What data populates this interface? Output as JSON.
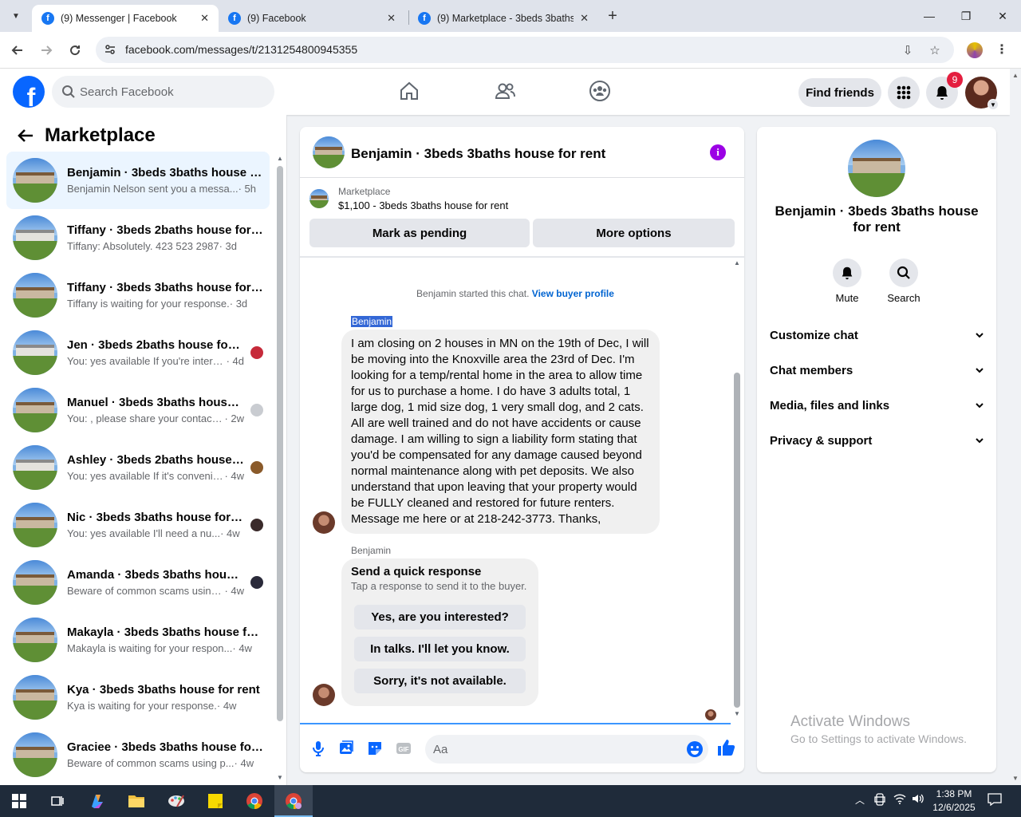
{
  "browser": {
    "tabs": [
      {
        "title": "(9) Messenger | Facebook",
        "active": true
      },
      {
        "title": "(9) Facebook",
        "active": false
      },
      {
        "title": "(9) Marketplace - 3beds 3baths",
        "active": false
      }
    ],
    "url": "facebook.com/messages/t/2131254800945355"
  },
  "fb_header": {
    "search_placeholder": "Search Facebook",
    "find_friends": "Find friends",
    "notification_count": "9"
  },
  "left_panel": {
    "title": "Marketplace",
    "conversations": [
      {
        "name": "Benjamin · 3beds 3baths house for rent",
        "preview": "Benjamin Nelson sent you a messa...",
        "time": "· 5h",
        "selected": true,
        "thumb": "brick"
      },
      {
        "name": "Tiffany · 3beds 2baths house for rent",
        "preview": "Tiffany: Absolutely. 423 523 2987",
        "time": "· 3d",
        "thumb": "white"
      },
      {
        "name": "Tiffany · 3beds 3baths house for rent",
        "preview": "Tiffany is waiting for your response.",
        "time": "· 3d",
        "thumb": "brick"
      },
      {
        "name": "Jen · 3beds 2baths house for rent",
        "preview": "You: yes available If you're intere...",
        "time": "· 4d",
        "thumb": "white",
        "mini": "#c62a3a"
      },
      {
        "name": "Manuel · 3beds 3baths house for rent",
        "preview": "You: , please share your contact ...",
        "time": "· 2w",
        "thumb": "brick",
        "mini": "#c9ccd1"
      },
      {
        "name": "Ashley · 3beds 2baths house for rent",
        "preview": "You: yes available If it's convenie...",
        "time": "· 4w",
        "thumb": "white",
        "mini": "#8a5a2a"
      },
      {
        "name": "Nic · 3beds 3baths house for rent",
        "preview": "You: yes available I'll need a nu...",
        "time": "· 4w",
        "thumb": "brick",
        "mini": "#3a2a2a"
      },
      {
        "name": "Amanda · 3beds 3baths house for rent",
        "preview": "Beware of common scams using...",
        "time": "· 4w",
        "thumb": "brick",
        "mini": "#2a2a3a"
      },
      {
        "name": "Makayla · 3beds 3baths house for rent",
        "preview": "Makayla is waiting for your respon...",
        "time": "· 4w",
        "thumb": "brick"
      },
      {
        "name": "Kya · 3beds 3baths house for rent",
        "preview": "Kya is waiting for your response.",
        "time": "· 4w",
        "thumb": "brick"
      },
      {
        "name": "Graciee · 3beds 3baths house for rent",
        "preview": "Beware of common scams using p...",
        "time": "· 4w",
        "thumb": "brick"
      }
    ]
  },
  "chat": {
    "title": "Benjamin · 3beds 3baths house for rent",
    "marketplace_label": "Marketplace",
    "listing": "$1,100 - 3beds 3baths house for rent",
    "mark_pending": "Mark as pending",
    "more_options": "More options",
    "started_text": "Benjamin started this chat.",
    "view_buyer_profile": "View buyer profile",
    "sender": "Benjamin",
    "message": "I am closing on 2 houses in MN on the 19th of Dec, I will be moving into the Knoxville area the 23rd of Dec. I'm looking for a temp/rental home in the area to allow time for us to purchase a home. I do have 3 adults total, 1 large dog, 1 mid size dog, 1 very small dog, and 2 cats. All are well trained and do not have accidents or cause damage. I am willing to sign a liability form stating that you'd be compensated for any damage caused beyond normal maintenance along with pet deposits. We also understand that upon leaving that your property would be FULLY cleaned and restored for future renters. Message me here or at 218-242-3773. Thanks,",
    "quick_title": "Send a quick response",
    "quick_sub": "Tap a response to send it to the buyer.",
    "quick_replies": [
      "Yes, are you interested?",
      "In talks. I'll let you know.",
      "Sorry, it's not available."
    ],
    "composer_placeholder": "Aa"
  },
  "right_panel": {
    "title": "Benjamin · 3beds 3baths house for rent",
    "mute": "Mute",
    "search": "Search",
    "sections": [
      "Customize chat",
      "Chat members",
      "Media, files and links",
      "Privacy & support"
    ]
  },
  "watermark": {
    "line1": "Activate Windows",
    "line2": "Go to Settings to activate Windows."
  },
  "taskbar": {
    "time": "1:38 PM",
    "date": "12/6/2025"
  },
  "colors": {
    "fb_blue": "#0866ff",
    "selected_bg": "#ebf5ff",
    "badge_red": "#e41e3f",
    "info_purple": "#9b00e5"
  }
}
